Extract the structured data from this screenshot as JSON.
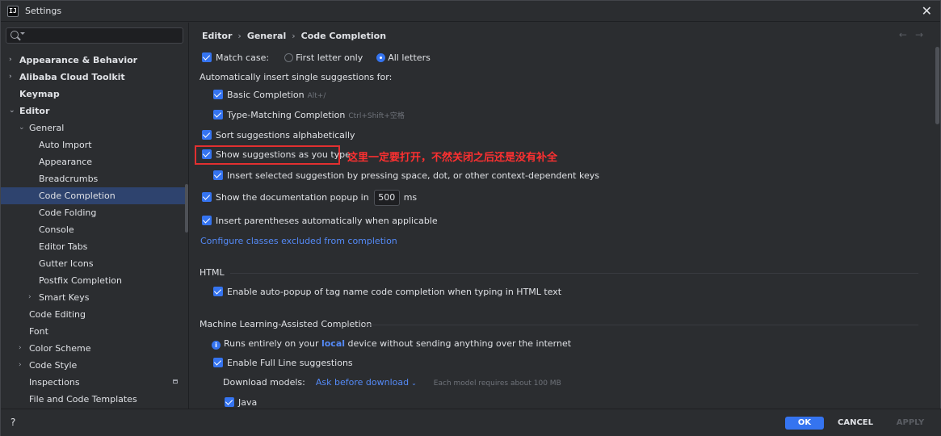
{
  "window": {
    "title": "Settings",
    "app_icon_text": "IJ"
  },
  "search": {
    "placeholder": ""
  },
  "sidebar": {
    "items": [
      {
        "label": "Appearance & Behavior",
        "arrow": "›",
        "bold": true
      },
      {
        "label": "Alibaba Cloud Toolkit",
        "arrow": "›",
        "bold": true
      },
      {
        "label": "Keymap",
        "arrow": "",
        "bold": true
      },
      {
        "label": "Editor",
        "arrow": "⌄",
        "bold": true
      },
      {
        "label": "General",
        "arrow": "⌄"
      },
      {
        "label": "Auto Import"
      },
      {
        "label": "Appearance"
      },
      {
        "label": "Breadcrumbs"
      },
      {
        "label": "Code Completion",
        "selected": true
      },
      {
        "label": "Code Folding"
      },
      {
        "label": "Console"
      },
      {
        "label": "Editor Tabs"
      },
      {
        "label": "Gutter Icons"
      },
      {
        "label": "Postfix Completion"
      },
      {
        "label": "Smart Keys",
        "arrow": "›"
      },
      {
        "label": "Code Editing"
      },
      {
        "label": "Font"
      },
      {
        "label": "Color Scheme",
        "arrow": "›"
      },
      {
        "label": "Code Style",
        "arrow": "›"
      },
      {
        "label": "Inspections"
      },
      {
        "label": "File and Code Templates"
      }
    ]
  },
  "breadcrumb": {
    "part1": "Editor",
    "part2": "General",
    "part3": "Code Completion",
    "sep": "›"
  },
  "nav": {
    "back": "←",
    "forward": "→"
  },
  "content": {
    "match_case": {
      "label": "Match case:",
      "opt1": "First letter only",
      "opt2": "All letters",
      "selected": "All letters"
    },
    "auto_insert_title": "Automatically insert single suggestions for:",
    "basic_completion": {
      "label": "Basic Completion",
      "hint": "Alt+/"
    },
    "type_matching": {
      "label": "Type-Matching Completion",
      "hint": "Ctrl+Shift+空格"
    },
    "sort_alpha": "Sort suggestions alphabetically",
    "show_as_you_type": "Show suggestions as you type",
    "annotation": "这里一定要打开，不然关闭之后还是没有补全",
    "insert_selected": "Insert selected suggestion by pressing space, dot, or other context-dependent keys",
    "doc_popup": {
      "label": "Show the documentation popup in",
      "value": "500",
      "unit": "ms"
    },
    "insert_parens": "Insert parentheses automatically when applicable",
    "configure_link": "Configure classes excluded from completion",
    "html_section": "HTML",
    "html_autopopup": "Enable auto-popup of tag name code completion when typing in HTML text",
    "ml_section": "Machine Learning-Assisted Completion",
    "ml_info": {
      "before": "Runs entirely on your ",
      "bold": "local",
      "after": " device without sending anything over the internet"
    },
    "full_line": "Enable Full Line suggestions",
    "download": {
      "label": "Download models:",
      "value": "Ask before download",
      "hint": "Each model requires about 100 MB"
    },
    "java": "Java"
  },
  "footer": {
    "help": "?",
    "ok": "OK",
    "cancel": "CANCEL",
    "apply": "APPLY"
  },
  "colors": {
    "accent": "#3574f0",
    "selection": "#2e436e",
    "link": "#548af7",
    "annotation": "#ff3030"
  }
}
